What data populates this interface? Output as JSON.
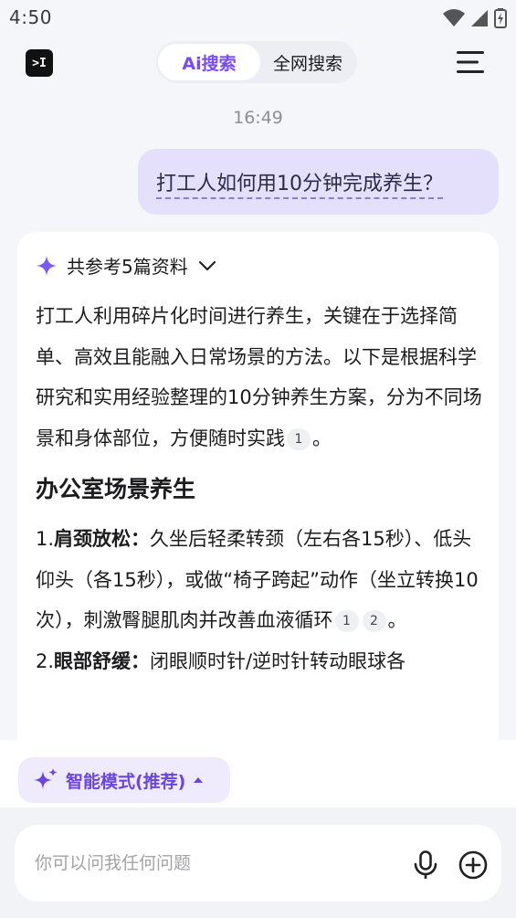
{
  "status_bar": {
    "time": "4:50"
  },
  "header": {
    "logo_text": ">I",
    "tabs": [
      {
        "label": "Ai搜索",
        "active": true
      },
      {
        "label": "全网搜索",
        "active": false
      }
    ]
  },
  "chat": {
    "timestamp": "16:49",
    "user_message": "打工人如何用10分钟完成养生？",
    "answer": {
      "refs_label": "共参考5篇资料",
      "intro": "打工人利用碎片化时间进行养生，关键在于选择简单、高效且能融入日常场景的方法。以下是根据科学研究和实用经验整理的10分钟养生方案，分为不同场景和身体部位，方便随时实践",
      "intro_cites": [
        "1"
      ],
      "intro_end": "。",
      "section_title": "办公室场景养生",
      "items": [
        {
          "num": "1.",
          "title": "肩颈放松",
          "colon": "：",
          "text": "久坐后轻柔转颈（左右各15秒）、低头仰头（各15秒），或做“椅子跨起”动作（坐立转换10次），刺激臀腿肌肉并改善血液循环",
          "cites": [
            "1",
            "2"
          ],
          "end": "。"
        },
        {
          "num": "2.",
          "title": "眼部舒缓",
          "colon": "：",
          "text": "闭眼顺时针/逆时针转动眼球各",
          "cites": [],
          "end": ""
        }
      ]
    }
  },
  "mode_selector": {
    "label": "智能模式(推荐)"
  },
  "input": {
    "placeholder": "你可以问我任何问题",
    "value": ""
  },
  "colors": {
    "accent": "#7a4df0",
    "bubble": "#e4e0fb",
    "chip": "#efebfd"
  }
}
